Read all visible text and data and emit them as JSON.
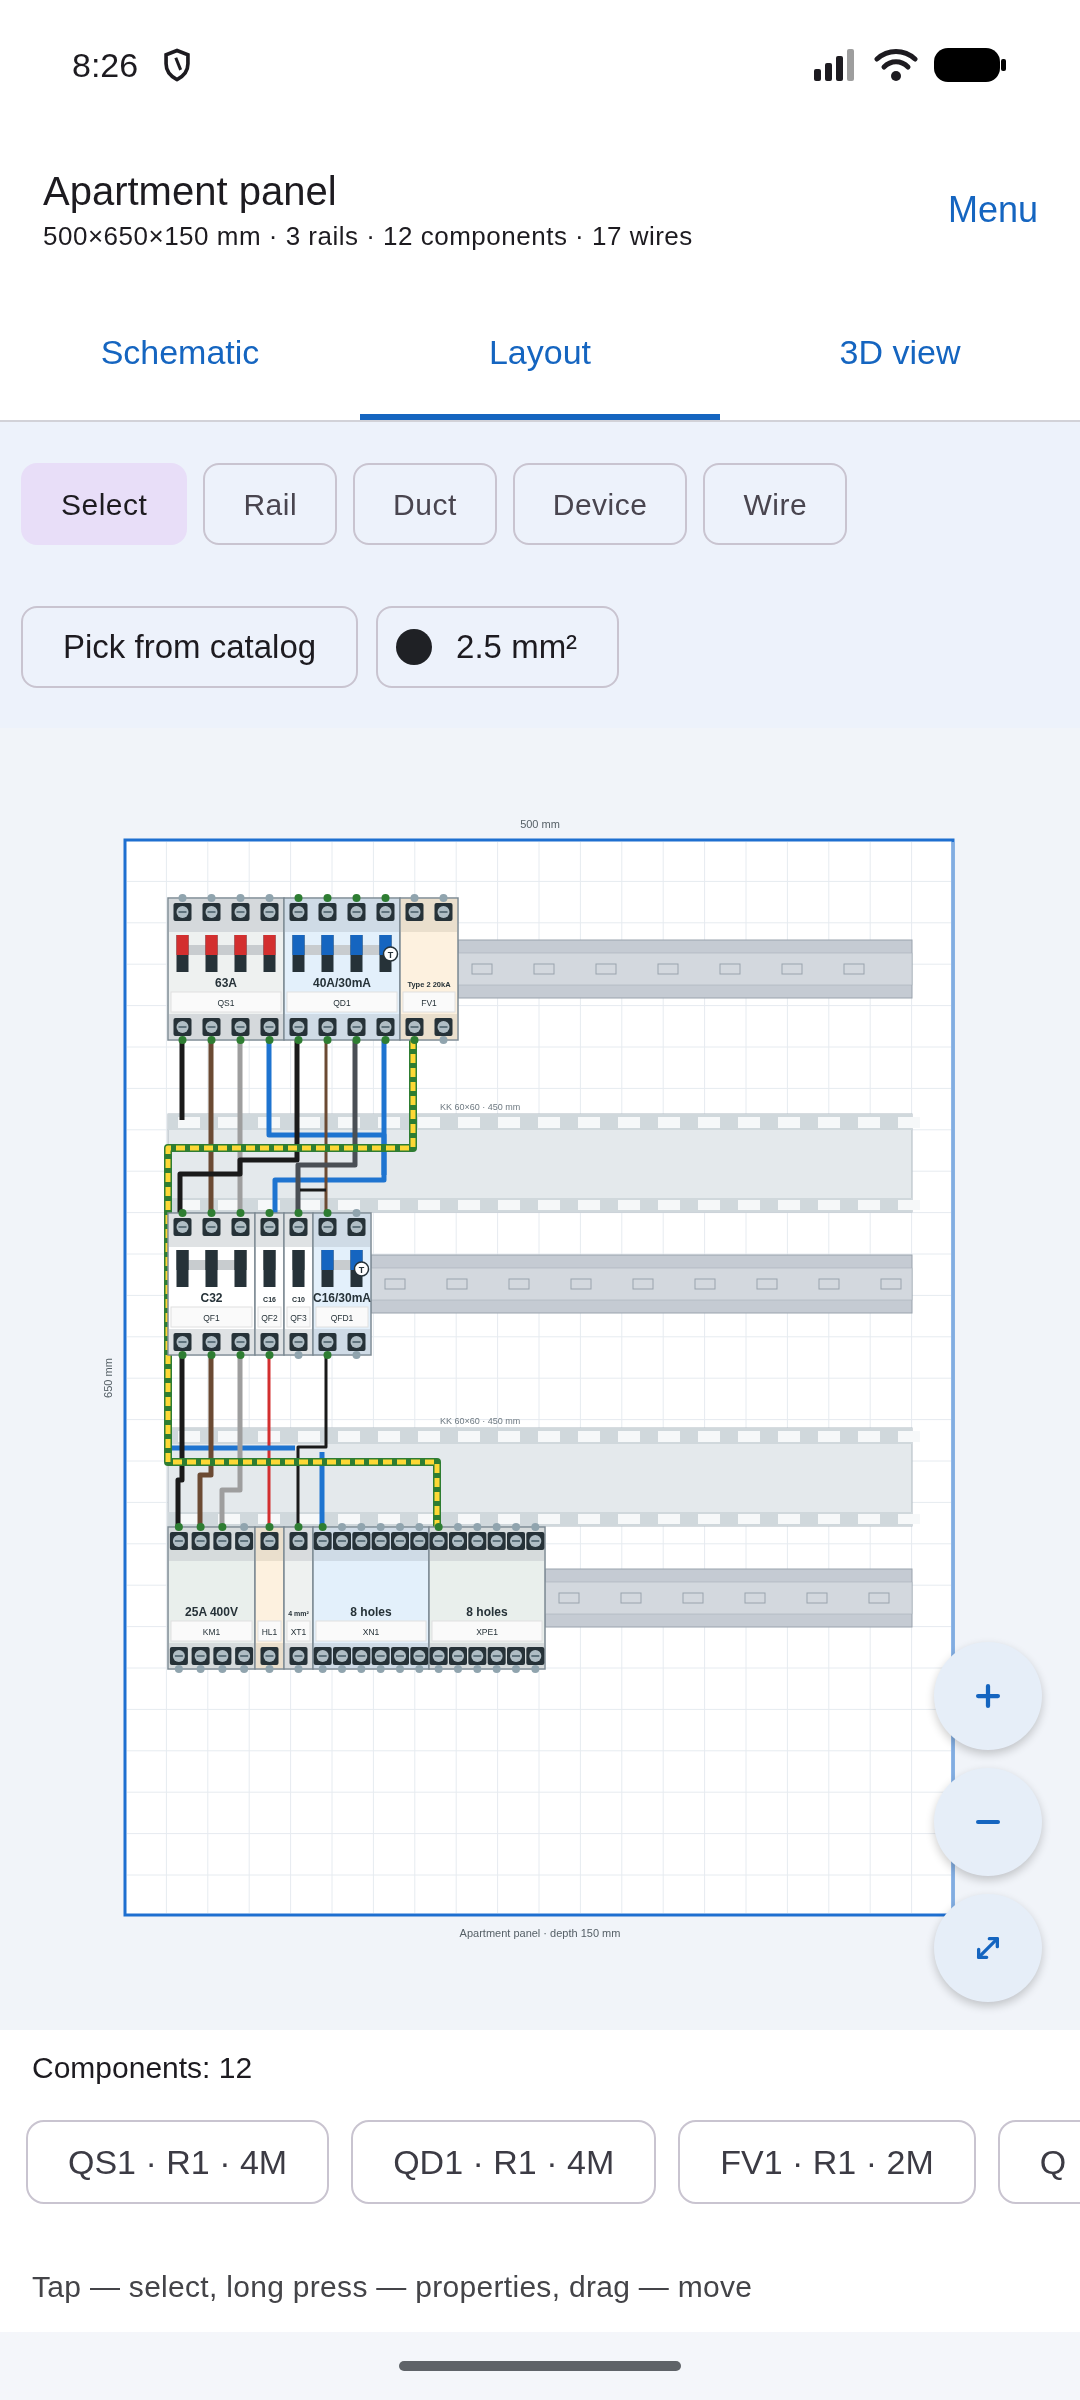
{
  "status_bar": {
    "time": "8:26"
  },
  "header": {
    "title": "Apartment panel",
    "subtitle": "500×650×150 mm · 3 rails · 12 components · 17 wires",
    "menu": "Menu"
  },
  "tabs": [
    {
      "label": "Schematic",
      "selected": false
    },
    {
      "label": "Layout",
      "selected": true
    },
    {
      "label": "3D view",
      "selected": false
    }
  ],
  "tools": [
    {
      "label": "Select",
      "selected": true
    },
    {
      "label": "Rail",
      "selected": false
    },
    {
      "label": "Duct",
      "selected": false
    },
    {
      "label": "Device",
      "selected": false
    },
    {
      "label": "Wire",
      "selected": false
    }
  ],
  "actions": {
    "catalog": "Pick from catalog",
    "wire_size": "2.5 mm²"
  },
  "panel": {
    "width_label": "500 mm",
    "height_label": "650 mm",
    "caption": "Apartment panel · depth 150 mm",
    "ducts": [
      {
        "label": "KK 60×60 · 450 mm"
      },
      {
        "label": "KK 60×60 · 450 mm"
      }
    ],
    "rails": [
      {
        "devices": [
          {
            "kind": "switch",
            "label": "QS1",
            "rating": "63A",
            "top": [
              false,
              false,
              false,
              false
            ],
            "bottom": [
              true,
              true,
              true,
              true
            ]
          },
          {
            "kind": "rcd",
            "label": "QD1",
            "rating": "40A/30mA",
            "test": "T",
            "top": [
              true,
              true,
              true,
              true
            ],
            "bottom": [
              true,
              true,
              true,
              true
            ]
          },
          {
            "kind": "spd",
            "label": "FV1",
            "rating": "Type 2 20kA",
            "top": [
              false,
              false
            ],
            "bottom": [
              true,
              false
            ]
          }
        ]
      },
      {
        "devices": [
          {
            "kind": "mcb",
            "label": "QF1",
            "rating": "C32",
            "top": [
              true,
              true,
              true
            ],
            "bottom": [
              true,
              true,
              true
            ]
          },
          {
            "kind": "mcb",
            "label": "QF2",
            "rating": "C16",
            "top": [
              true
            ],
            "bottom": [
              true
            ]
          },
          {
            "kind": "mcb",
            "label": "QF3",
            "rating": "C10",
            "top": [
              true
            ],
            "bottom": [
              false
            ]
          },
          {
            "kind": "rcd",
            "label": "QFD1",
            "rating": "C16/30mA",
            "test": "T",
            "top": [
              true,
              false
            ],
            "bottom": [
              true,
              false
            ]
          }
        ]
      },
      {
        "devices": [
          {
            "kind": "contactor",
            "label": "KM1",
            "rating": "25A 400V",
            "top": [
              true,
              true,
              true,
              false
            ],
            "bottom": [
              false,
              false,
              false,
              false
            ]
          },
          {
            "kind": "lamp",
            "label": "HL1",
            "top": [
              true
            ],
            "bottom": [
              false
            ]
          },
          {
            "kind": "terminal",
            "label": "XT1",
            "rating": "4 mm²",
            "top": [
              true
            ],
            "bottom": [
              false
            ]
          },
          {
            "kind": "neutral",
            "label": "XN1",
            "rating": "8 holes",
            "top": [
              true,
              false,
              false,
              false,
              false,
              false
            ],
            "bottom": [
              false,
              false,
              false,
              false,
              false,
              false
            ]
          },
          {
            "kind": "earth",
            "label": "XPE1",
            "rating": "8 holes",
            "top": [
              true,
              false,
              false,
              false,
              false,
              false
            ],
            "bottom": [
              false,
              false,
              false,
              false,
              false,
              false
            ]
          }
        ]
      }
    ]
  },
  "components": {
    "title": "Components: 12",
    "chips": [
      "QS1 · R1 · 4M",
      "QD1 · R1 · 4M",
      "FV1 · R1 · 2M",
      "Q"
    ]
  },
  "hint": "Tap — select, long press — properties, drag — move"
}
